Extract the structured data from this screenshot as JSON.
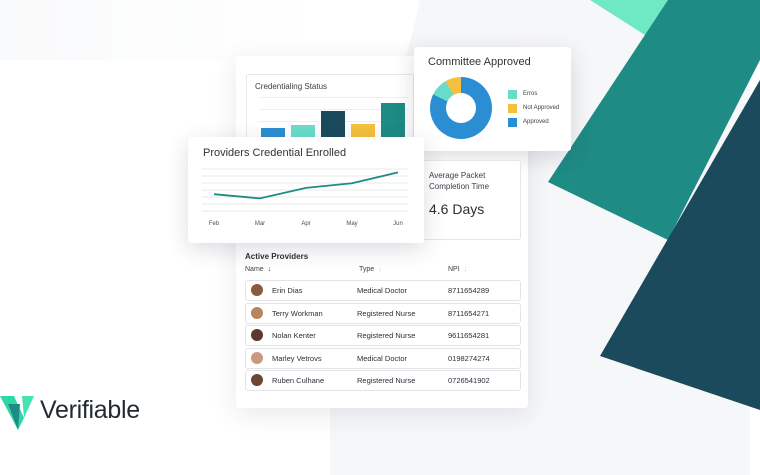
{
  "brand": {
    "name": "Verifiable"
  },
  "credentialing_status": {
    "title": "Credentialing Status",
    "bar_colors": [
      "#2b8ed2",
      "#69dcc9",
      "#1b4a5c",
      "#f3c13d",
      "#1e8b84"
    ],
    "bar_values": [
      0.22,
      0.3,
      0.65,
      0.32,
      0.85
    ]
  },
  "committee_approved": {
    "title": "Committee Approved",
    "legend": [
      {
        "label": "Erros",
        "color": "#69dcc9"
      },
      {
        "label": "Not Approved",
        "color": "#f3c13d"
      },
      {
        "label": "Approved",
        "color": "#2b8ed2"
      }
    ]
  },
  "avg_packet": {
    "label": "Average Packet Completion Time",
    "value": "4.6 Days"
  },
  "chart_data": {
    "type": "line",
    "title": "Providers Credential Enrolled",
    "x": [
      "Feb",
      "Mar",
      "Apr",
      "May",
      "Jun"
    ],
    "series": [
      {
        "values": [
          0.4,
          0.3,
          0.55,
          0.66,
          0.92
        ]
      }
    ],
    "grid": true,
    "color": "#1e8b84"
  },
  "active_providers": {
    "title": "Active Providers",
    "columns": [
      "Name",
      "Type",
      "NPI"
    ],
    "rows": [
      {
        "name": "Erin Dias",
        "type": "Medical Doctor",
        "npi": "8711654289",
        "avatar": "#8a5a3c"
      },
      {
        "name": "Terry Workman",
        "type": "Registered Nurse",
        "npi": "8711654271",
        "avatar": "#b8865e"
      },
      {
        "name": "Nolan Kenter",
        "type": "Registered Nurse",
        "npi": "9611654281",
        "avatar": "#5a3a2a"
      },
      {
        "name": "Marley Vetrovs",
        "type": "Medical Doctor",
        "npi": "0198274274",
        "avatar": "#c99a7e"
      },
      {
        "name": "Ruben Culhane",
        "type": "Registered Nurse",
        "npi": "0726541902",
        "avatar": "#6b4632"
      }
    ]
  }
}
